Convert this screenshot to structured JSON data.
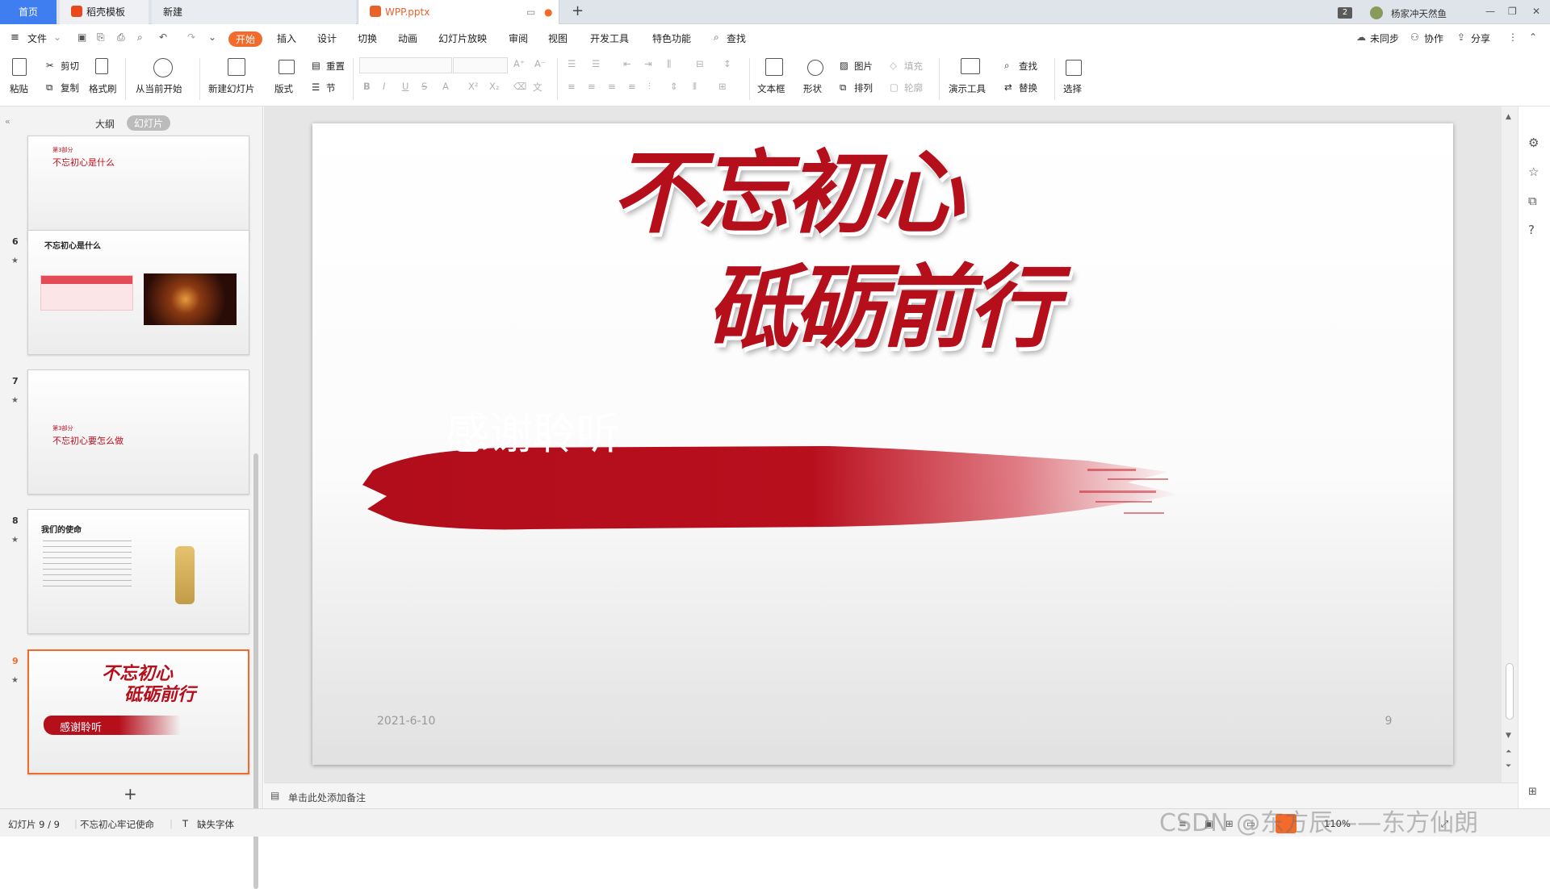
{
  "titlebar": {
    "tab_home": "首页",
    "tab_daoke": "稻壳模板",
    "tab_new": "新建",
    "tab_file": "WPP.pptx",
    "add_tab": "+",
    "badge": "2",
    "username": "杨家冲天然鱼",
    "win_min": "—",
    "win_max": "❐",
    "win_close": "✕"
  },
  "menu": {
    "file": "文件",
    "start": "开始",
    "insert": "插入",
    "design": "设计",
    "switch": "切换",
    "animation": "动画",
    "slideshow": "幻灯片放映",
    "review": "审阅",
    "view": "视图",
    "devtools": "开发工具",
    "special": "特色功能",
    "search": "查找",
    "sync": "未同步",
    "collab": "协作",
    "share": "分享"
  },
  "ribbon": {
    "paste": "粘贴",
    "cut": "剪切",
    "copy": "复制",
    "format_painter": "格式刷",
    "from_current": "从当前开始",
    "new_slide": "新建幻灯片",
    "layout": "版式",
    "reset": "重置",
    "section": "节",
    "text_box": "文本框",
    "shape": "形状",
    "picture": "图片",
    "arrange": "排列",
    "fill": "填充",
    "outline": "轮廓",
    "present_tool": "演示工具",
    "find": "查找",
    "replace": "替换",
    "select": "选择"
  },
  "left_panel": {
    "tab_outline": "大纲",
    "tab_slides": "幻灯片",
    "add_slide": "+",
    "thumbs": [
      {
        "num": "",
        "part": "第3部分",
        "title": "不忘初心是什么"
      },
      {
        "num": "6",
        "title": "不忘初心是什么"
      },
      {
        "num": "7",
        "part": "第3部分",
        "title": "不忘初心要怎么做"
      },
      {
        "num": "8",
        "title": "我们的使命"
      },
      {
        "num": "9",
        "title_a": "不忘初心",
        "title_b": "砥砺前行",
        "thanks": "感谢聆听"
      }
    ]
  },
  "slide": {
    "title_line1": "不忘初心",
    "title_line2": "砥砺前行",
    "thanks": "感谢聆听",
    "date": "2021-6-10",
    "page": "9"
  },
  "notes": {
    "placeholder": "单击此处添加备注"
  },
  "status": {
    "slide_count": "幻灯片 9 / 9",
    "theme": "不忘初心牢记使命",
    "missing_font": "缺失字体",
    "zoom": "110%",
    "watermark": "CSDN @东方辰——东方仙朗"
  },
  "colors": {
    "accent": "#f26b2a",
    "brand_red": "#c0101e",
    "home_tab": "#3f7ef0"
  }
}
